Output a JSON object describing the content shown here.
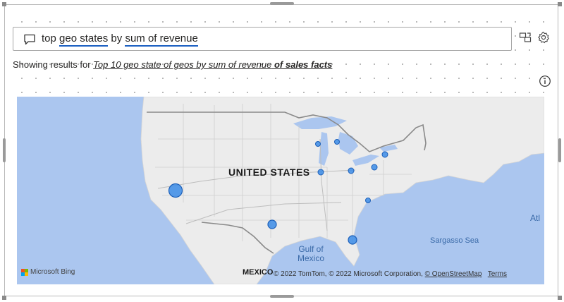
{
  "query": {
    "part1": "top ",
    "part2": "geo states",
    "part3": " by ",
    "part4": "sum of revenue"
  },
  "results": {
    "prefix": "Showing results for ",
    "link_text": "Top 10 geo state of geos by sum of revenue",
    "link_suffix": " of sales facts"
  },
  "map": {
    "labels": {
      "country": "UNITED STATES",
      "gulf_line1": "Gulf of",
      "gulf_line2": "Mexico",
      "sargasso": "Sargasso Sea",
      "atlantic": "Atl",
      "mexico": "MEXICO"
    },
    "attribution": {
      "brand": "Microsoft Bing",
      "copyright": "© 2022 TomTom, © 2022 Microsoft Corporation, ",
      "osm": "© OpenStreetMap",
      "terms": "Terms"
    },
    "bubble_color": "#3b8ce8",
    "land_color": "#ececec",
    "water_color": "#abc6ef"
  },
  "icons": [
    "chat-icon",
    "share-visual-icon",
    "settings-gear-icon",
    "info-icon"
  ]
}
